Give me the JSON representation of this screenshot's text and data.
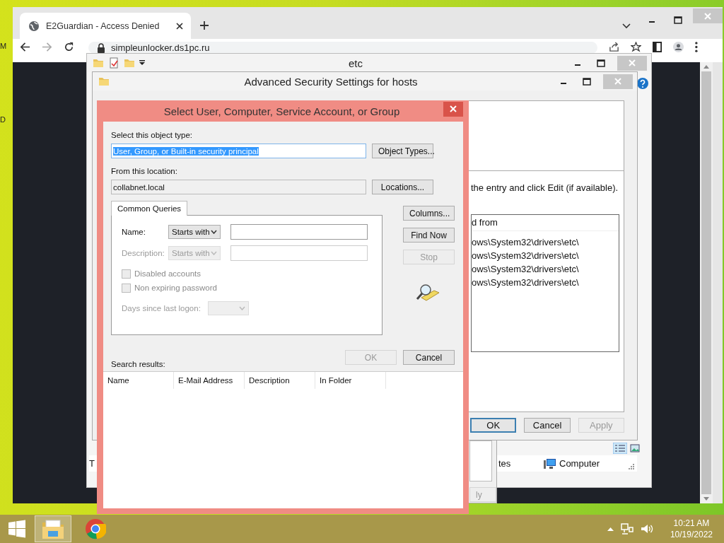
{
  "desktop": {
    "edge_labels": [
      "M",
      "D"
    ]
  },
  "browser": {
    "tabs": [
      {
        "title": "E2Guardian - Access Denied",
        "selected": true
      }
    ],
    "url": "simpleunlocker.ds1pc.ru"
  },
  "explorer": {
    "title": "etc",
    "status_items": [
      "T",
      "tes",
      "Computer"
    ]
  },
  "properties_window": {
    "button": {
      "label": "ly",
      "disabled": true
    }
  },
  "security_window": {
    "title": "Advanced Security Settings for hosts",
    "instruction": "the entry and click Edit (if available).",
    "list_header": "d from",
    "rows": [
      "ows\\System32\\drivers\\etc\\",
      "ows\\System32\\drivers\\etc\\",
      "ows\\System32\\drivers\\etc\\",
      "ows\\System32\\drivers\\etc\\"
    ],
    "buttons": [
      {
        "label": "OK",
        "disabled": false,
        "default": true
      },
      {
        "label": "Cancel",
        "disabled": false,
        "default": false
      },
      {
        "label": "Apply",
        "disabled": true,
        "default": false
      }
    ]
  },
  "dialog": {
    "title": "Select User, Computer, Service Account, or Group",
    "object_type_label": "Select this object type:",
    "object_type_value": "User, Group, or Built-in security principal",
    "object_types_button": "Object Types...",
    "location_label": "From this location:",
    "location_value": "collabnet.local",
    "locations_button": "Locations...",
    "tabs": [
      {
        "label": "Common Queries",
        "selected": true
      }
    ],
    "fields": [
      {
        "label": "Name:",
        "operator": "Starts with",
        "disabled": false
      },
      {
        "label": "Description:",
        "operator": "Starts with",
        "disabled": true
      }
    ],
    "checkboxes": [
      {
        "label": "Disabled accounts",
        "checked": false,
        "disabled": true
      },
      {
        "label": "Non expiring password",
        "checked": false,
        "disabled": true
      }
    ],
    "days_label": "Days since last logon:",
    "side_buttons": [
      {
        "label": "Columns...",
        "disabled": false
      },
      {
        "label": "Find Now",
        "disabled": false
      },
      {
        "label": "Stop",
        "disabled": true
      }
    ],
    "ok_button": {
      "label": "OK",
      "disabled": true
    },
    "cancel_button": {
      "label": "Cancel",
      "disabled": false
    },
    "results_label": "Search results:",
    "columns": [
      "Name",
      "E-Mail Address",
      "Description",
      "In Folder"
    ]
  },
  "taskbar": {
    "apps": [
      {
        "kind": "explorer",
        "selected": true
      },
      {
        "kind": "chrome",
        "selected": false
      }
    ],
    "time": "10:21 AM",
    "date": "10/19/2022"
  }
}
